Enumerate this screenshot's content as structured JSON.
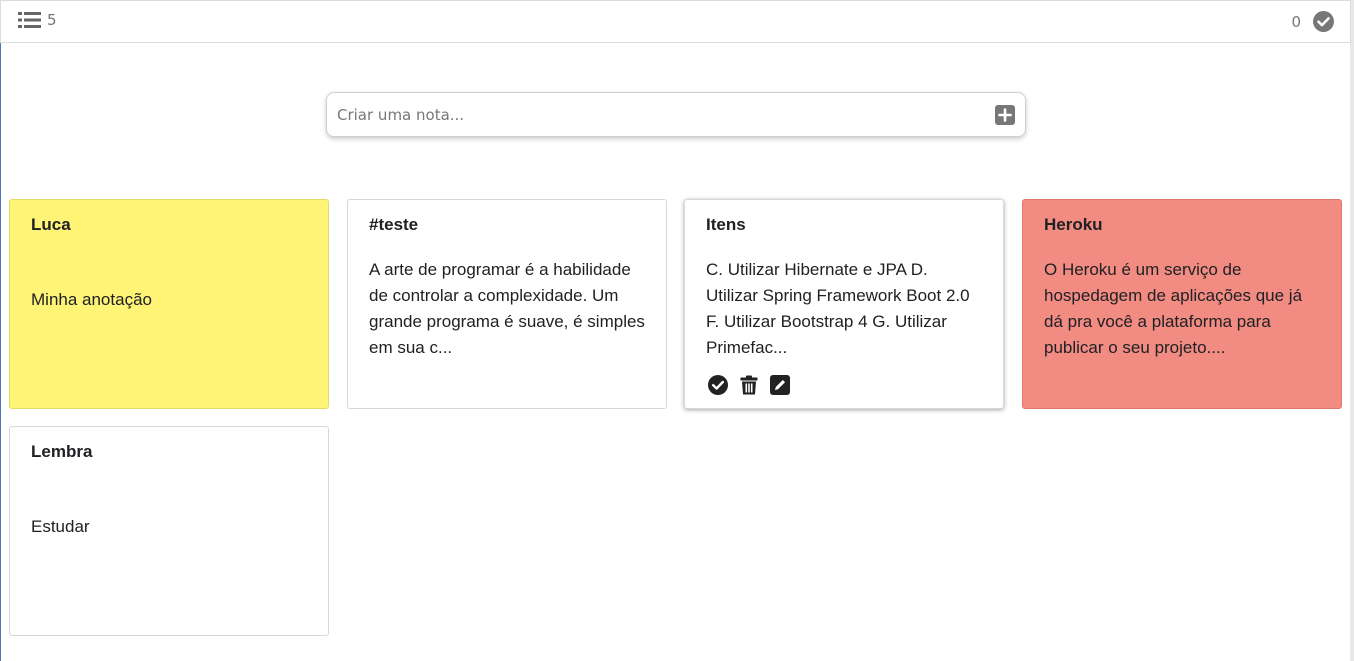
{
  "header": {
    "list_count": "5",
    "done_count": "0"
  },
  "search": {
    "placeholder": "Criar uma nota..."
  },
  "notes": [
    {
      "title": "Luca",
      "body": "Minha anotação",
      "color": "#fff475"
    },
    {
      "title": "#teste",
      "body": "A arte de programar é a habilidade de controlar a complexidade. Um grande programa é suave, é simples em sua c...",
      "color": "#ffffff"
    },
    {
      "title": "Itens",
      "body": "C. Utilizar Hibernate e JPA D. Utilizar Spring Framework Boot 2.0 F. Utilizar Bootstrap 4 G. Utilizar Primefac...",
      "color": "#ffffff"
    },
    {
      "title": "Heroku",
      "body": "O Heroku é um serviço de hospedagem de aplicações que já dá pra você a plataforma para publicar o seu projeto....",
      "color": "#f28b82"
    },
    {
      "title": "Lembra",
      "body": "Estudar",
      "color": "#ffffff"
    }
  ],
  "icons": {
    "list": "list-icon",
    "done": "check-circle-icon",
    "add": "plus-square-icon",
    "complete": "check-circle-icon",
    "delete": "trash-icon",
    "edit": "edit-icon"
  }
}
